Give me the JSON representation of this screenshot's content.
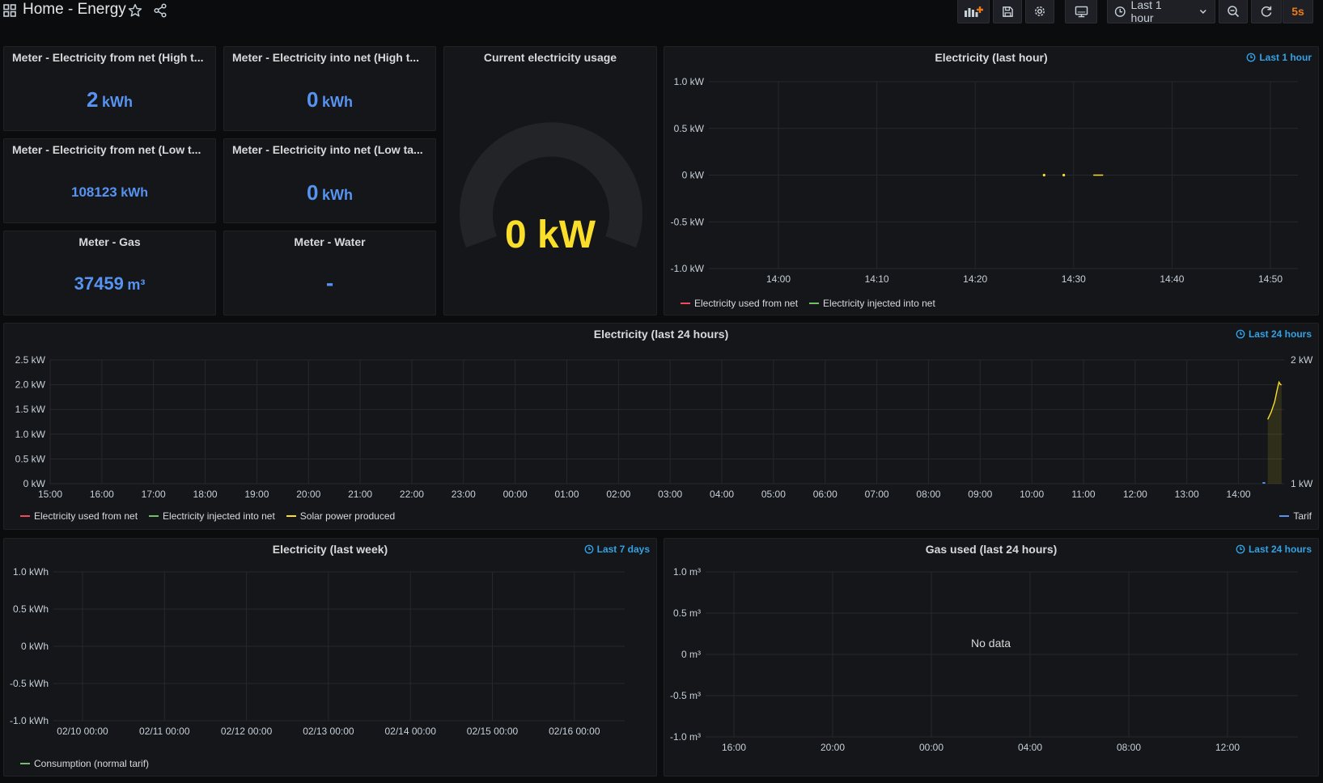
{
  "header": {
    "title": "Home - Energy",
    "time_range": "Last 1 hour",
    "refresh": "5s"
  },
  "icons": [
    "apps-icon",
    "star-icon",
    "share-icon",
    "add-panel-icon",
    "save-icon",
    "settings-icon",
    "tv-mode-icon",
    "clock-icon",
    "chevron-down-icon",
    "zoom-out-icon",
    "refresh-icon"
  ],
  "colors": {
    "stat_blue": "#5794f2",
    "gauge_value": "#fade2a",
    "time_override": "#33a2e5",
    "series_red": "#f2495c",
    "series_green": "#73bf69",
    "series_yellow": "#fade2a",
    "tarif_blue": "#5794f2",
    "refresh_orange": "#eb7b18"
  },
  "stats": [
    {
      "title": "Meter - Electricity from net (High t...",
      "value": "2",
      "unit": "kWh"
    },
    {
      "title": "Meter - Electricity into net (High t...",
      "value": "0",
      "unit": "kWh"
    },
    {
      "title": "Meter - Electricity from net (Low t...",
      "value": "108123",
      "unit": "kWh"
    },
    {
      "title": "Meter - Electricity into net (Low ta...",
      "value": "0",
      "unit": "kWh"
    },
    {
      "title": "Meter - Gas",
      "value": "37459",
      "unit": "m³"
    },
    {
      "title": "Meter - Water",
      "value": "-",
      "unit": ""
    }
  ],
  "gauge": {
    "title": "Current electricity usage",
    "value": "0 kW",
    "level": 0
  },
  "panels": {
    "last_hour": {
      "title": "Electricity (last hour)",
      "time_info": "Last 1 hour"
    },
    "last_24h": {
      "title": "Electricity (last 24 hours)",
      "time_info": "Last 24 hours"
    },
    "last_week": {
      "title": "Electricity (last week)",
      "time_info": "Last 7 days"
    },
    "gas_24h": {
      "title": "Gas used (last 24 hours)",
      "time_info": "Last 24 hours",
      "no_data": "No data"
    }
  },
  "chart_data": [
    {
      "type": "line",
      "title": "Electricity (last hour)",
      "x_ticks": [
        "14:00",
        "14:10",
        "14:20",
        "14:30",
        "14:40",
        "14:50"
      ],
      "y_ticks": [
        "1.0 kW",
        "0.5 kW",
        "0 kW",
        "-0.5 kW",
        "-1.0 kW"
      ],
      "ylim": [
        -1.0,
        1.0
      ],
      "legend": [
        "Electricity used from net",
        "Electricity injected into net"
      ],
      "legend_placement": "bottom-left",
      "grid": true,
      "series": [
        {
          "name": "Electricity used from net",
          "x": [
            "14:27",
            "14:29",
            "14:32",
            "14:33"
          ],
          "y": [
            0,
            0,
            0,
            0
          ]
        }
      ]
    },
    {
      "type": "area",
      "title": "Electricity (last 24 hours)",
      "x_ticks": [
        "15:00",
        "16:00",
        "17:00",
        "18:00",
        "19:00",
        "20:00",
        "21:00",
        "22:00",
        "23:00",
        "00:00",
        "01:00",
        "02:00",
        "03:00",
        "04:00",
        "05:00",
        "06:00",
        "07:00",
        "08:00",
        "09:00",
        "10:00",
        "11:00",
        "12:00",
        "13:00",
        "14:00"
      ],
      "y_ticks": [
        "2.5 kW",
        "2.0 kW",
        "1.5 kW",
        "1.0 kW",
        "0.5 kW",
        "0 kW"
      ],
      "y2_ticks": [
        "2 kW",
        "1 kW"
      ],
      "ylim": [
        0,
        2.5
      ],
      "y2lim": [
        1,
        2
      ],
      "legend": [
        "Electricity used from net",
        "Electricity injected into net",
        "Solar power produced"
      ],
      "legend_right": [
        "Tarif"
      ],
      "legend_placement": "bottom",
      "grid": true,
      "series": [
        {
          "name": "Solar power produced",
          "x": [
            "14:34",
            "14:38",
            "14:42",
            "14:45",
            "14:47",
            "14:49",
            "14:50"
          ],
          "y": [
            1.3,
            1.45,
            1.65,
            1.9,
            2.05,
            2.0,
            2.0
          ]
        },
        {
          "name": "Tarif",
          "x": [
            "14:28",
            "14:31"
          ],
          "y": [
            1,
            1
          ]
        }
      ]
    },
    {
      "type": "line",
      "title": "Electricity (last week)",
      "x_ticks": [
        "02/10 00:00",
        "02/11 00:00",
        "02/12 00:00",
        "02/13 00:00",
        "02/14 00:00",
        "02/15 00:00",
        "02/16 00:00"
      ],
      "y_ticks": [
        "1.0 kWh",
        "0.5 kWh",
        "0 kWh",
        "-0.5 kWh",
        "-1.0 kWh"
      ],
      "ylim": [
        -1.0,
        1.0
      ],
      "legend": [
        "Consumption (normal tarif)"
      ],
      "legend_placement": "bottom-left",
      "grid": true,
      "series": []
    },
    {
      "type": "line",
      "title": "Gas used (last 24 hours)",
      "x_ticks": [
        "16:00",
        "20:00",
        "00:00",
        "04:00",
        "08:00",
        "12:00"
      ],
      "y_ticks": [
        "1.0 m³",
        "0.5 m³",
        "0 m³",
        "-0.5 m³",
        "-1.0 m³"
      ],
      "ylim": [
        -1.0,
        1.0
      ],
      "grid": true,
      "series": []
    }
  ]
}
